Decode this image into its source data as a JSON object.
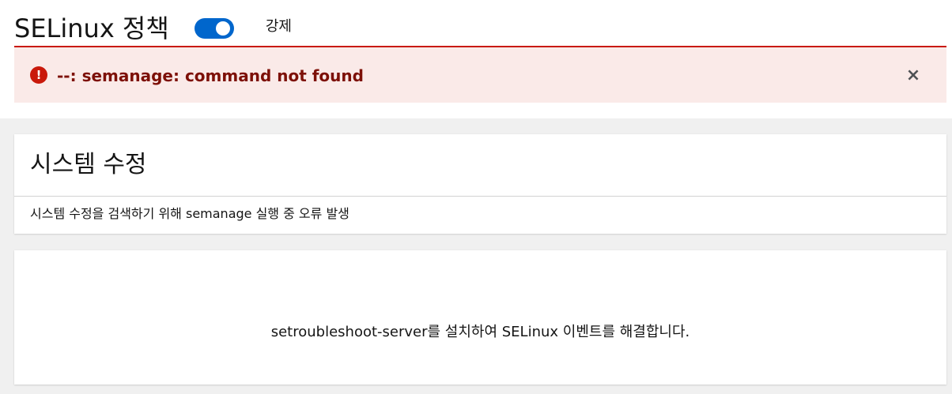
{
  "header": {
    "title": "SELinux 정책",
    "toggle_state": "on",
    "toggle_label": "강제"
  },
  "alert": {
    "icon": "exclamation-circle-icon",
    "message": "--: semanage: command not found",
    "close_label": "×",
    "color": "#c9190b"
  },
  "system_modifications": {
    "title": "시스템 수정",
    "message": "시스템 수정을 검색하기 위해 semanage 실행 중 오류 발생"
  },
  "events": {
    "message": "setroubleshoot-server를 설치하여 SELinux 이벤트를 해결합니다."
  },
  "colors": {
    "accent": "#0066cc",
    "danger": "#c9190b",
    "danger_text": "#7d1007",
    "alert_bg": "#faeae8",
    "page_bg": "#f0f0f0"
  }
}
